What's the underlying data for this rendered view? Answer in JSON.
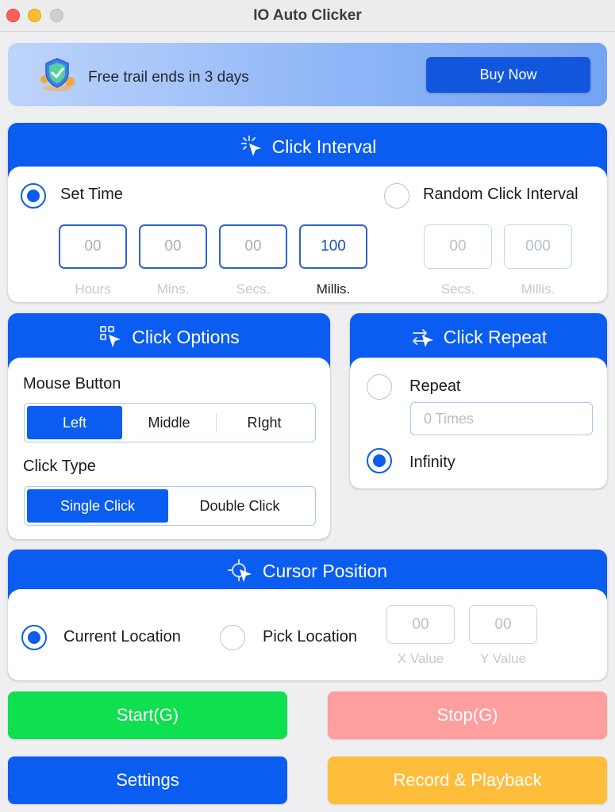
{
  "window": {
    "title": "IO Auto Clicker"
  },
  "banner": {
    "text": "Free trail ends in 3 days",
    "buy_label": "Buy Now"
  },
  "click_interval": {
    "title": "Click Interval",
    "set_time": {
      "label": "Set Time",
      "selected": true
    },
    "random": {
      "label": "Random Click Interval",
      "selected": false
    },
    "fields": [
      {
        "value": "00",
        "caption": "Hours"
      },
      {
        "value": "00",
        "caption": "Mins."
      },
      {
        "value": "00",
        "caption": "Secs."
      },
      {
        "value": "100",
        "caption": "Millis."
      }
    ],
    "random_fields": [
      {
        "value": "00",
        "caption": "Secs."
      },
      {
        "value": "000",
        "caption": "Millis."
      }
    ]
  },
  "click_options": {
    "title": "Click Options",
    "mouse_button_label": "Mouse Button",
    "mouse_buttons": [
      "Left",
      "Middle",
      "RIght"
    ],
    "mouse_selected": "Left",
    "click_type_label": "Click Type",
    "click_types": [
      "Single Click",
      "Double Click"
    ],
    "click_type_selected": "Single Click"
  },
  "click_repeat": {
    "title": "Click Repeat",
    "repeat_label": "Repeat",
    "times_placeholder": "0 Times",
    "infinity_label": "Infinity",
    "selected": "Infinity"
  },
  "cursor_position": {
    "title": "Cursor Position",
    "current_label": "Current Location",
    "pick_label": "Pick Location",
    "x": {
      "value": "00",
      "caption": "X Value"
    },
    "y": {
      "value": "00",
      "caption": "Y Value"
    },
    "selected": "Current Location"
  },
  "actions": {
    "start": "Start(G)",
    "stop": "Stop(G)",
    "settings": "Settings",
    "record": "Record & Playback"
  },
  "colors": {
    "accent": "#0b5cf0",
    "start": "#0fe04f",
    "stop": "#ff9e9e",
    "record": "#ffbd3c",
    "settings": "#0b5cf0"
  }
}
